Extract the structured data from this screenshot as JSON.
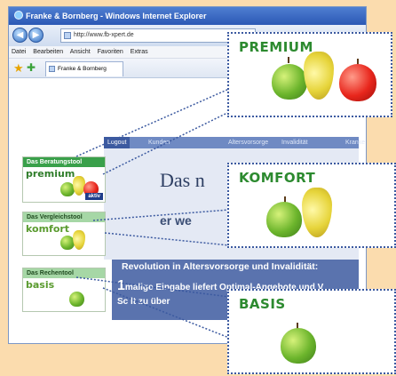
{
  "browser": {
    "window_title": "Franke & Bornberg - Windows Internet Explorer",
    "url": "http://www.fb-xpert.de",
    "menu": [
      "Datei",
      "Bearbeiten",
      "Ansicht",
      "Favoriten",
      "Extras"
    ],
    "tab_title": "Franke & Bornberg"
  },
  "page": {
    "nav": [
      "Logout",
      "Kunden",
      "Altersvorsorge",
      "Invalidität",
      "Kranke"
    ],
    "title_fragment": "Das n",
    "subtitle_fragment": "er we",
    "revolution_line1": "Revolution in Altersvorsorge und Invalidität:",
    "revolution_big": "1",
    "revolution_line2": "malige Eingabe liefert Optimal-Angebote und V",
    "revolution_line3": "Sc      lt zu über"
  },
  "tiles": [
    {
      "caption": "Das Beratungstool",
      "name": "premium",
      "badge": "aktiv"
    },
    {
      "caption": "Das Vergleichstool",
      "name": "komfort"
    },
    {
      "caption": "Das Rechentool",
      "name": "basis"
    }
  ],
  "callouts": [
    {
      "title": "PREMIUM"
    },
    {
      "title": "KOMFORT"
    },
    {
      "title": "BASIS"
    }
  ],
  "colors": {
    "background": "#fbdcae",
    "brand_green": "#2c8a2f",
    "link_blue": "#3c5aa0"
  }
}
